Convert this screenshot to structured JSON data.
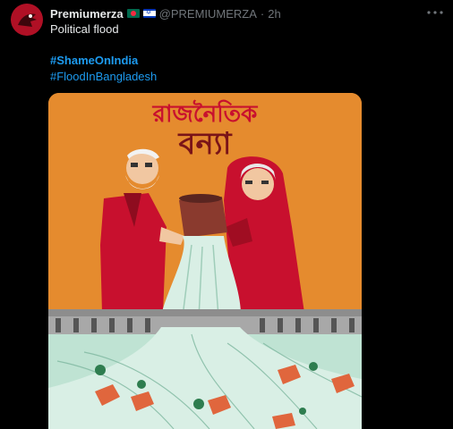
{
  "author": {
    "display_name": "Premiumerza",
    "handle": "@PREMIUMERZA",
    "separator": "·",
    "time": "2h"
  },
  "tweet": {
    "text": "Political flood",
    "hashtags": [
      "#ShameOnIndia",
      "#FloodInBangladesh"
    ]
  },
  "media": {
    "title_line1": "রাজনৈতিক",
    "title_line2": "বন্যা",
    "background_color": "#e58b2e",
    "figure_color": "#c8102e",
    "water_color": "#bfe3d3"
  },
  "icons": {
    "more": "more-options-icon",
    "flag_1": "bangladesh-flag-icon",
    "flag_2": "israel-flag-icon"
  }
}
